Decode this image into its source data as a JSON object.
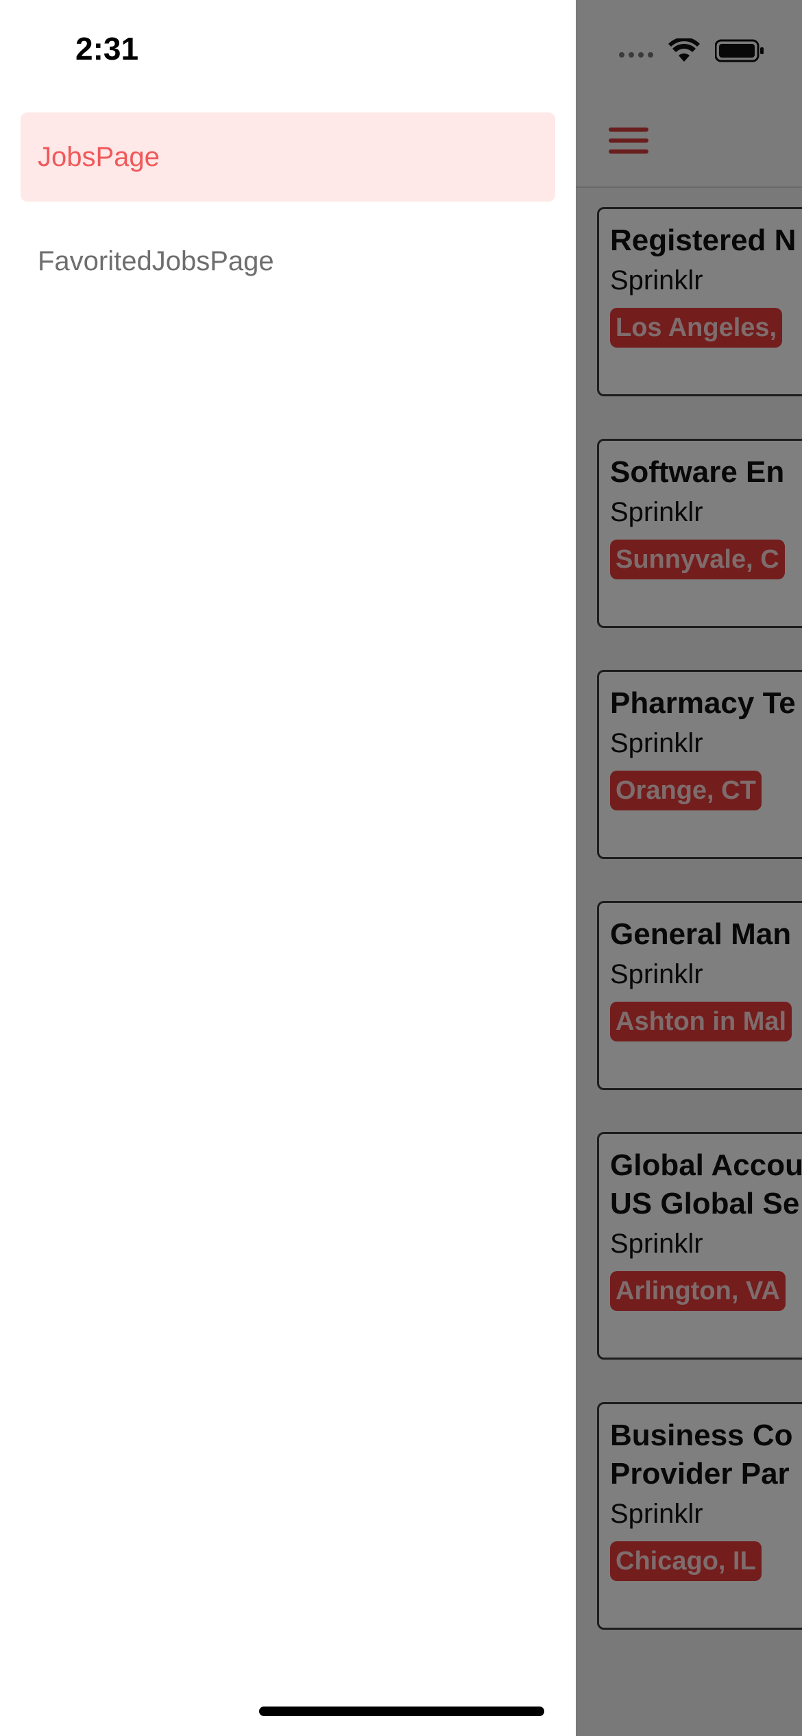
{
  "status_bar": {
    "time": "2:31"
  },
  "drawer": {
    "items": [
      {
        "label": "JobsPage",
        "active": true
      },
      {
        "label": "FavoritedJobsPage",
        "active": false
      }
    ]
  },
  "jobs": [
    {
      "title": "Registered N",
      "company": "Sprinklr",
      "location": "Los Angeles,"
    },
    {
      "title": "Software En",
      "company": "Sprinklr",
      "location": "Sunnyvale, C"
    },
    {
      "title": "Pharmacy Te",
      "company": "Sprinklr",
      "location": "Orange, CT"
    },
    {
      "title": "General Man",
      "company": "Sprinklr",
      "location": "Ashton in Mal"
    },
    {
      "title": "Global Accou",
      "title_line2": "US Global Se",
      "company": "Sprinklr",
      "location": "Arlington, VA"
    },
    {
      "title": "Business Co",
      "title_line2": "Provider Par",
      "company": "Sprinklr",
      "location": "Chicago, IL"
    }
  ],
  "colors": {
    "accent": "#d23a3a",
    "active_item_bg": "#ffe8e8",
    "active_item_text": "#f0595a",
    "location_badge": "#e63b3b"
  }
}
